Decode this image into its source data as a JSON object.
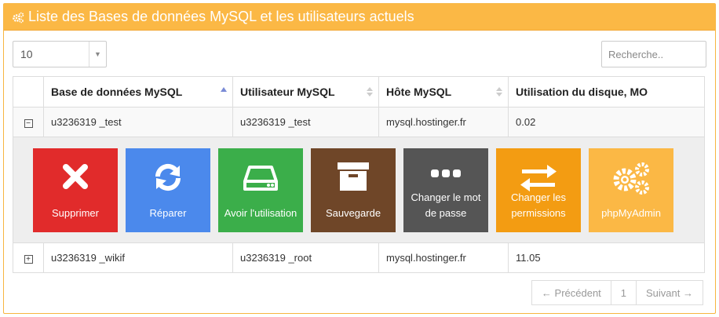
{
  "panel": {
    "title": "Liste des Bases de données MySQL et les utilisateurs actuels",
    "accent": "#fbb845"
  },
  "toolbar": {
    "page_size": "10",
    "search_placeholder": "Recherche.."
  },
  "table": {
    "headers": [
      "Base de données MySQL",
      "Utilisateur MySQL",
      "Hôte MySQL",
      "Utilisation du disque, MO"
    ],
    "rows": [
      {
        "toggle": "−",
        "database": "u3236319 _test",
        "user": "u3236319 _test",
        "host": "mysql.hostinger.fr",
        "usage": "0.02"
      },
      {
        "toggle": "+",
        "database": "u3236319 _wikif",
        "user": "u3236319 _root",
        "host": "mysql.hostinger.fr",
        "usage": "11.05"
      }
    ]
  },
  "actions": [
    {
      "label": "Supprimer",
      "icon": "close-icon",
      "color": "#e12b2b"
    },
    {
      "label": "Réparer",
      "icon": "refresh-icon",
      "color": "#4b89ec"
    },
    {
      "label": "Avoir l'utilisation",
      "icon": "hard-drive-icon",
      "color": "#3bae4a"
    },
    {
      "label": "Sauvegarde",
      "icon": "archive-box-icon",
      "color": "#6f4628"
    },
    {
      "label": "Changer le mot de passe",
      "icon": "password-dots-icon",
      "color": "#555555"
    },
    {
      "label": "Changer les permissions",
      "icon": "swap-arrows-icon",
      "color": "#f39c12"
    },
    {
      "label": "phpMyAdmin",
      "icon": "gears-icon",
      "color": "#fbb845"
    }
  ],
  "pagination": {
    "prev": "← Précédent",
    "current": "1",
    "next": "Suivant →"
  }
}
